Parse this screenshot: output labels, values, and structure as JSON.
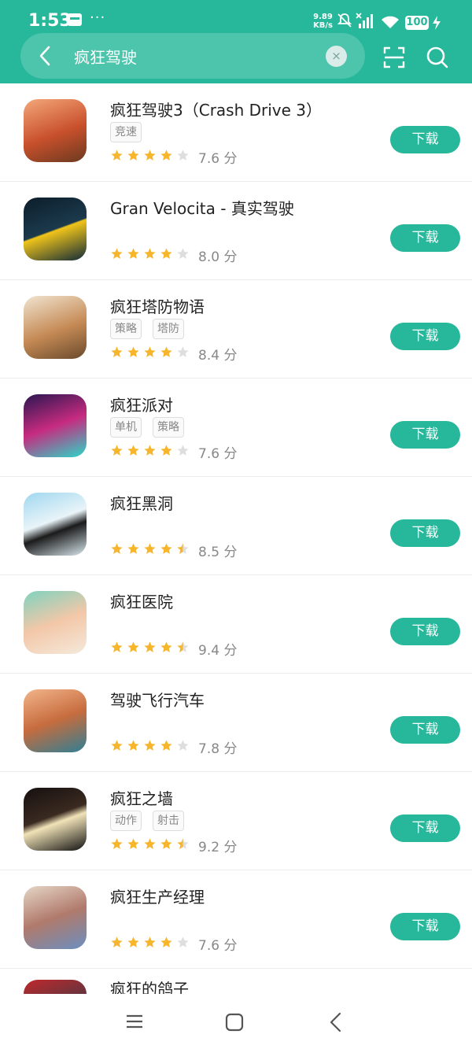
{
  "status_bar": {
    "time": "1:53",
    "dots": "···",
    "net_speed_value": "9.89",
    "net_speed_unit": "KB/s",
    "battery": "100"
  },
  "search": {
    "query": "疯狂驾驶",
    "clear_symbol": "×"
  },
  "colors": {
    "accent": "#27b79a",
    "star": "#f7b52c",
    "star_empty": "#dedede"
  },
  "download_label": "下载",
  "score_unit": "分",
  "apps": [
    {
      "name": "疯狂驾驶3（Crash Drive 3）",
      "tags": [
        "竞速"
      ],
      "rating": 4.0,
      "score": "7.6"
    },
    {
      "name": "Gran Velocita - 真实驾驶",
      "tags": [],
      "rating": 4.0,
      "score": "8.0"
    },
    {
      "name": "疯狂塔防物语",
      "tags": [
        "策略",
        "塔防"
      ],
      "rating": 4.0,
      "score": "8.4"
    },
    {
      "name": "疯狂派对",
      "tags": [
        "单机",
        "策略"
      ],
      "rating": 4.0,
      "score": "7.6"
    },
    {
      "name": "疯狂黑洞",
      "tags": [],
      "rating": 4.5,
      "score": "8.5"
    },
    {
      "name": "疯狂医院",
      "tags": [],
      "rating": 4.5,
      "score": "9.4"
    },
    {
      "name": "驾驶飞行汽车",
      "tags": [],
      "rating": 4.0,
      "score": "7.8"
    },
    {
      "name": "疯狂之墙",
      "tags": [
        "动作",
        "射击"
      ],
      "rating": 4.5,
      "score": "9.2"
    },
    {
      "name": "疯狂生产经理",
      "tags": [],
      "rating": 4.0,
      "score": "7.6"
    }
  ],
  "partial_app": {
    "name": "疯狂的鸽子"
  }
}
